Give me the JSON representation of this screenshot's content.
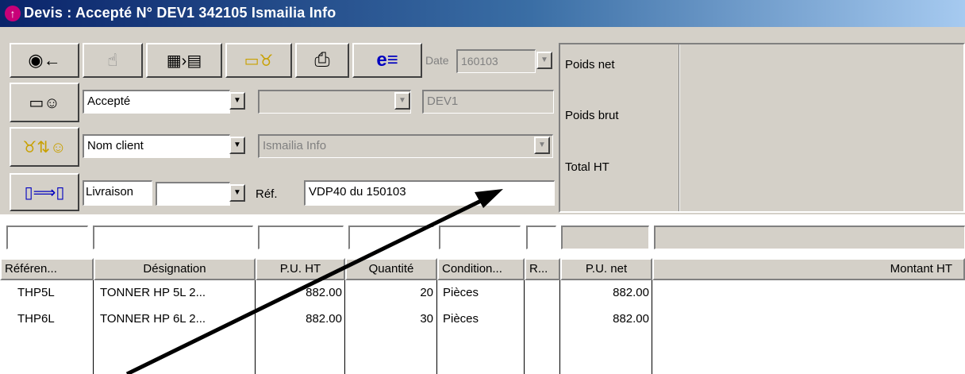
{
  "window": {
    "title": "Devis : Accepté N° DEV1 342105 Ismailia Info"
  },
  "toolbar": {
    "back_icon": "back-arrow-icon",
    "hand_icon": "hand-pointer-icon",
    "calc_icon": "calculator-to-document-icon",
    "money_icon": "money-bag-folder-icon",
    "print_icon": "printer-icon",
    "email_icon": "email-icon"
  },
  "header": {
    "date_label": "Date",
    "date_value": "160103",
    "status_value": "Accepté",
    "code_value": "DEV1",
    "client_field": "Nom client",
    "client_value": "Ismailia Info",
    "livraison_label": "Livraison",
    "ref_label": "Réf.",
    "ref_value": "VDP40 du 150103"
  },
  "summary": {
    "poids_net_label": "Poids net",
    "poids_brut_label": "Poids brut",
    "total_ht_label": "Total HT"
  },
  "table": {
    "columns": [
      "Référen...",
      "Désignation",
      "P.U. HT",
      "Quantité",
      "Condition...",
      "R...",
      "P.U. net",
      "Montant HT"
    ],
    "rows": [
      {
        "ref": "THP5L",
        "designation": "TONNER HP 5L  2...",
        "pu_ht": "882.00",
        "quantite": "20",
        "condition": "Pièces",
        "r": "",
        "pu_net": "882.00",
        "montant": ""
      },
      {
        "ref": "THP6L",
        "designation": "TONNER HP 6L 2...",
        "pu_ht": "882.00",
        "quantite": "30",
        "condition": "Pièces",
        "r": "",
        "pu_net": "882.00",
        "montant": ""
      }
    ]
  },
  "colors": {
    "title_start": "#0a246a",
    "title_end": "#a6caf0",
    "panel": "#d4d0c8"
  }
}
